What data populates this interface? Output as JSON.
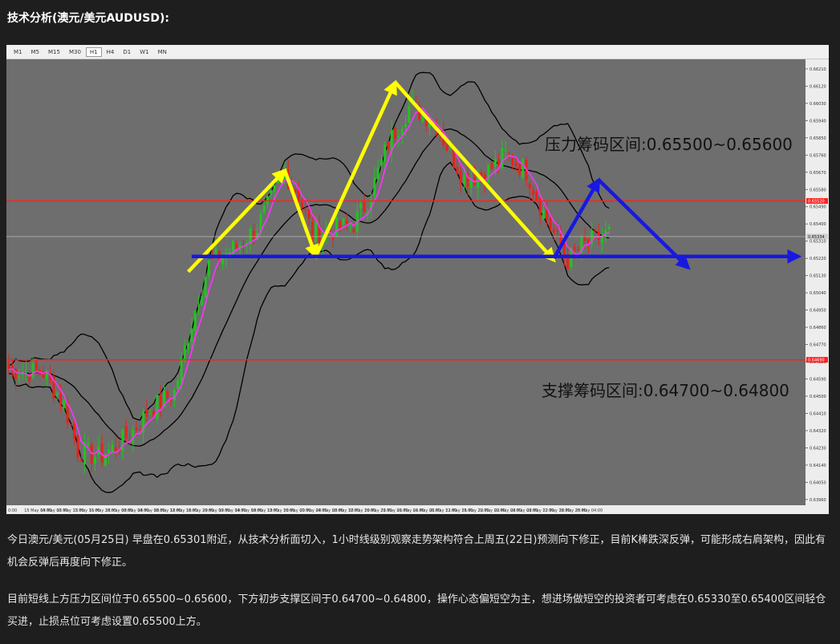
{
  "heading": "技术分析(澳元/美元AUDUSD):",
  "toolbar": {
    "timeframes": [
      "M1",
      "M5",
      "M15",
      "M30",
      "H1",
      "H4",
      "D1",
      "W1",
      "MN"
    ],
    "active": "H1"
  },
  "chart_data": {
    "type": "candlestick",
    "ylim": [
      0.6393,
      0.6626
    ],
    "y_ticks": [
      "0.66210",
      "0.66120",
      "0.66030",
      "0.65940",
      "0.65850",
      "0.65760",
      "0.65670",
      "0.65580",
      "0.65490",
      "0.65400",
      "0.65310",
      "0.65220",
      "0.65130",
      "0.65040",
      "0.64950",
      "0.64860",
      "0.64770",
      "0.64680",
      "0.64590",
      "0.64500",
      "0.64410",
      "0.64320",
      "0.64230",
      "0.64140",
      "0.64050",
      "0.63960"
    ],
    "x_ticks": [
      "0:00",
      "15 May 04:00",
      "15 May 08:00",
      "15 May 12:00",
      "15 May 16:00",
      "15 May 20:00",
      "18 May 00:00",
      "18 May 04:00",
      "18 May 08:00",
      "18 May 12:00",
      "18 May 16:00",
      "18 May 20:00",
      "19 May 00:00",
      "19 May 04:00",
      "19 May 08:00",
      "19 May 12:00",
      "19 May 16:00",
      "20 May 00:00",
      "20 May 04:00",
      "20 May 08:00",
      "20 May 12:00",
      "20 May 16:00",
      "20 May 20:00",
      "21 May 00:00",
      "21 May 04:00",
      "21 May 08:00",
      "21 May 12:00",
      "21 May 16:00",
      "21 May 20:00",
      "22 May 00:00",
      "22 May 04:00",
      "22 May 08:00",
      "22 May 12:00",
      "22 May 16:00",
      "22 May 20:00",
      "25 May 04:00"
    ],
    "current_price": "0.65334",
    "resistance_line_label": "0.65520",
    "support_line_label": "0.64690",
    "resistance_line": 0.6552,
    "support_line": 0.6469,
    "current_line": 0.65334,
    "neckline": 0.6523,
    "candle_count": 175,
    "candle_anchors": [
      [
        0,
        0.6464
      ],
      [
        10,
        0.6462
      ],
      [
        16,
        0.6446
      ],
      [
        20,
        0.6422
      ],
      [
        26,
        0.6418
      ],
      [
        32,
        0.6425
      ],
      [
        36,
        0.6432
      ],
      [
        40,
        0.6441
      ],
      [
        44,
        0.6447
      ],
      [
        48,
        0.6452
      ],
      [
        52,
        0.6482
      ],
      [
        55,
        0.6502
      ],
      [
        58,
        0.6519
      ],
      [
        62,
        0.6524
      ],
      [
        66,
        0.6528
      ],
      [
        72,
        0.6538
      ],
      [
        80,
        0.6567
      ],
      [
        84,
        0.6555
      ],
      [
        88,
        0.6535
      ],
      [
        94,
        0.6537
      ],
      [
        100,
        0.654
      ],
      [
        104,
        0.6552
      ],
      [
        110,
        0.6582
      ],
      [
        116,
        0.6601
      ],
      [
        120,
        0.6598
      ],
      [
        124,
        0.6592
      ],
      [
        128,
        0.6577
      ],
      [
        132,
        0.6564
      ],
      [
        138,
        0.6566
      ],
      [
        144,
        0.6576
      ],
      [
        150,
        0.6568
      ],
      [
        154,
        0.655
      ],
      [
        158,
        0.6535
      ],
      [
        162,
        0.6521
      ],
      [
        166,
        0.6528
      ],
      [
        170,
        0.6532
      ],
      [
        174,
        0.6535
      ]
    ],
    "annotations": {
      "resistance_zone": "压力筹码区间:0.65500~0.65600",
      "support_zone": "支撑筹码区间:0.64700~0.64800"
    },
    "colors": {
      "background": "#6e6e6e",
      "bull_candle": "#22c322",
      "bear_candle": "#e8221a",
      "moving_average": "#ff33ff",
      "bollinger": "#000000",
      "zone_lines": "#ff2020",
      "pattern_arrows": "#ffff00",
      "neckline_arrows": "#1818e0"
    }
  },
  "paragraphs": [
    "今日澳元/美元(05月25日) 早盘在0.65301附近，从技术分析面切入，1小时线级别观察走势架构符合上周五(22日)预测向下修正，目前K棒跌深反弹，可能形成右肩架构，因此有机会反弹后再度向下修正。",
    "目前短线上方压力区间位于0.65500~0.65600，下方初步支撑区间于0.64700~0.64800，操作心态偏短空为主，想进场做短空的投资者可考虑在0.65330至0.65400区间轻仓买进，止损点位可考虑设置0.65500上方。"
  ]
}
